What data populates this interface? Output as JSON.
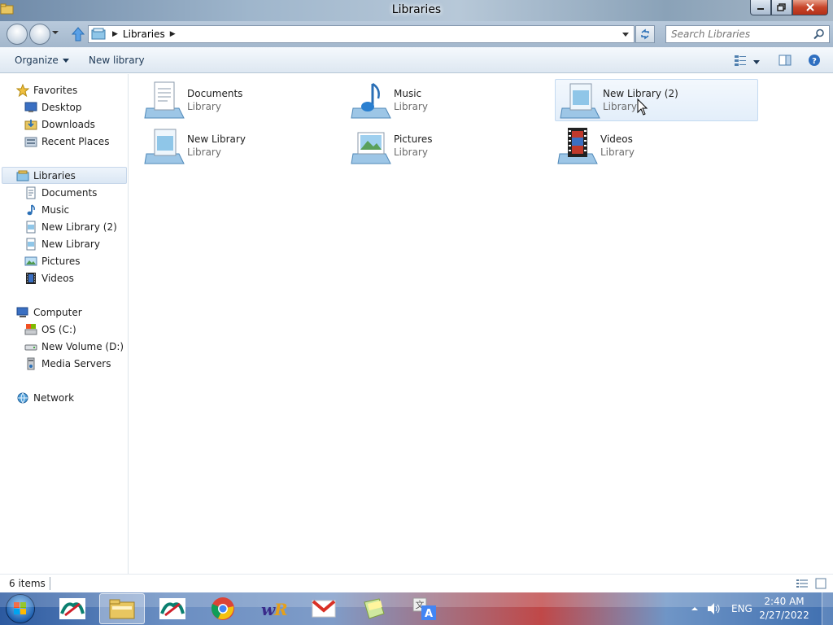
{
  "window": {
    "title": "Libraries"
  },
  "address": {
    "crumbs": [
      "Libraries"
    ],
    "search_placeholder": "Search Libraries"
  },
  "toolbar": {
    "organize_label": "Organize",
    "new_library_label": "New library"
  },
  "nav": {
    "favorites": {
      "label": "Favorites",
      "items": [
        "Desktop",
        "Downloads",
        "Recent Places"
      ]
    },
    "libraries": {
      "label": "Libraries",
      "items": [
        "Documents",
        "Music",
        "New Library (2)",
        "New Library",
        "Pictures",
        "Videos"
      ]
    },
    "computer": {
      "label": "Computer",
      "items": [
        "OS (C:)",
        "New Volume (D:)",
        "Media Servers"
      ]
    },
    "network": {
      "label": "Network"
    }
  },
  "content": {
    "tiles": [
      {
        "name": "Documents",
        "type": "Library"
      },
      {
        "name": "Music",
        "type": "Library"
      },
      {
        "name": "New Library (2)",
        "type": "Library"
      },
      {
        "name": "New Library",
        "type": "Library"
      },
      {
        "name": "Pictures",
        "type": "Library"
      },
      {
        "name": "Videos",
        "type": "Library"
      }
    ]
  },
  "status": {
    "item_count": "6 items"
  },
  "taskbar": {
    "language": "ENG",
    "time": "2:40 AM",
    "date": "2/27/2022",
    "pinned": [
      "ca-icon",
      "explorer-icon",
      "ca-icon",
      "chrome-icon",
      "winrar-icon",
      "gmail-icon",
      "notes-icon",
      "translate-icon"
    ]
  },
  "colors": {
    "accent": "#1e3956",
    "selection": "#dbe7f4",
    "secondary_text": "#6d6d6d"
  }
}
